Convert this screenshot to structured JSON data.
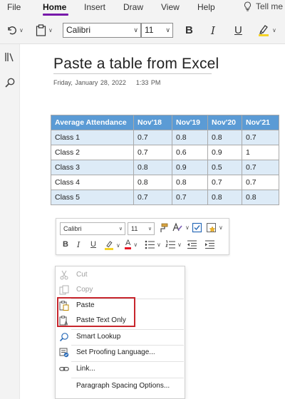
{
  "menu": {
    "items": [
      {
        "label": "File",
        "name": "menu-file"
      },
      {
        "label": "Home",
        "name": "menu-home"
      },
      {
        "label": "Insert",
        "name": "menu-insert"
      },
      {
        "label": "Draw",
        "name": "menu-draw"
      },
      {
        "label": "View",
        "name": "menu-view"
      },
      {
        "label": "Help",
        "name": "menu-help"
      }
    ],
    "active": "Home",
    "tell_me": "Tell me"
  },
  "ribbon": {
    "font": "Calibri",
    "size": "11",
    "bold": "B",
    "italic": "I",
    "underline": "U"
  },
  "page": {
    "title": "Paste a table from Excel",
    "date": "Friday, January 28, 2022",
    "time": "1:33 PM"
  },
  "table": {
    "headers": [
      "Average Attendance",
      "Nov'18",
      "Nov'19",
      "Nov'20",
      "Nov'21"
    ],
    "rows": [
      [
        "Class 1",
        "0.7",
        "0.8",
        "0.8",
        "0.7"
      ],
      [
        "Class 2",
        "0.7",
        "0.6",
        "0.9",
        "1"
      ],
      [
        "Class 3",
        "0.8",
        "0.9",
        "0.5",
        "0.7"
      ],
      [
        "Class 4",
        "0.8",
        "0.8",
        "0.7",
        "0.7"
      ],
      [
        "Class 5",
        "0.7",
        "0.7",
        "0.8",
        "0.8"
      ]
    ],
    "colors": {
      "header_bg": "#5b9bd5",
      "band_bg": "#ddebf7",
      "border": "#a9a9a9"
    }
  },
  "mini_toolbar": {
    "font": "Calibri",
    "size": "11",
    "bold": "B",
    "italic": "I",
    "underline": "U",
    "font_color": "A"
  },
  "context_menu": {
    "items": [
      {
        "label": "Cut",
        "icon": "scissors-icon",
        "enabled": false
      },
      {
        "label": "Copy",
        "icon": "copy-icon",
        "enabled": false
      },
      {
        "label": "Paste",
        "icon": "paste-icon",
        "enabled": true
      },
      {
        "label": "Paste Text Only",
        "icon": "paste-text-only-icon",
        "enabled": true
      },
      {
        "label": "Smart Lookup",
        "icon": "smart-lookup-icon",
        "enabled": true
      },
      {
        "label": "Set Proofing Language...",
        "icon": "proofing-language-icon",
        "enabled": true
      },
      {
        "label": "Link...",
        "icon": "link-icon",
        "enabled": true
      },
      {
        "label": "Paragraph Spacing Options...",
        "icon": "",
        "enabled": true
      }
    ],
    "highlight_color": "#c8262d"
  },
  "theme": {
    "accent": "#7719aa",
    "ribbon_bg": "#f3f3f3",
    "highlighter": "#f5d327",
    "font_color_red": "#e81123"
  }
}
